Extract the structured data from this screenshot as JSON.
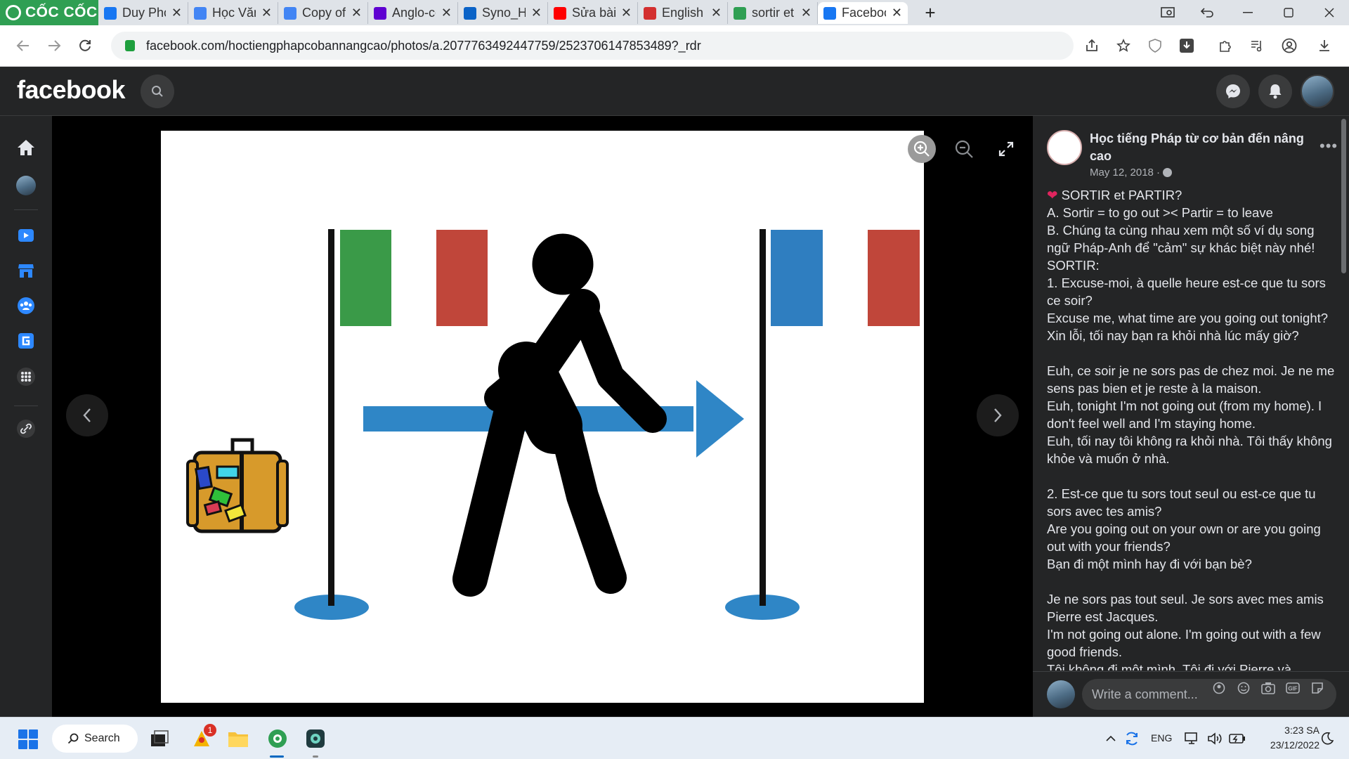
{
  "browser": {
    "brand": "CỐC CỐC",
    "tabs": [
      {
        "label": "Duy Phong",
        "favicon": "facebook-icon",
        "color": "#1877f2"
      },
      {
        "label": "Học Văn c",
        "favicon": "docs-icon",
        "color": "#4285f4"
      },
      {
        "label": "Copy of D",
        "favicon": "docs-icon",
        "color": "#4285f4"
      },
      {
        "label": "Anglo-cor",
        "favicon": "yahoo-icon",
        "color": "#5f01d1"
      },
      {
        "label": "Syno_Hyp",
        "favicon": "dsm-icon",
        "color": "#0b63c7"
      },
      {
        "label": "Sửa bài tậ",
        "favicon": "youtube-icon",
        "color": "#ff0000"
      },
      {
        "label": "English Tr",
        "favicon": "c-icon",
        "color": "#d32f2f"
      },
      {
        "label": "sortir et p",
        "favicon": "coccoc-icon",
        "color": "#2f9f53"
      },
      {
        "label": "Facebook",
        "favicon": "facebook-icon",
        "color": "#1877f2"
      }
    ],
    "url": "facebook.com/hoctiengphapcobannangcao/photos/a.2077763492447759/2523706147853489?_rdr"
  },
  "facebook": {
    "logo_text": "facebook"
  },
  "post": {
    "page_name": "Học tiếng Pháp từ cơ bản đến nâng cao",
    "date": "May 12, 2018 ·",
    "lines": [
      {
        "text": "SORTIR et PARTIR?",
        "heart": true
      },
      {
        "text": "A. Sortir = to go out >< Partir = to leave"
      },
      {
        "text": "B. Chúng ta cùng nhau xem một số ví dụ song ngữ Pháp-Anh để \"cảm\" sự khác biệt này nhé!"
      },
      {
        "text": "SORTIR:"
      },
      {
        "text": "1. Excuse-moi, à quelle heure est-ce que tu sors ce soir?"
      },
      {
        "text": "Excuse me, what time are you going out tonight?"
      },
      {
        "text": "Xin lỗi, tối nay bạn ra khỏi nhà lúc mấy giờ?"
      },
      {
        "text": ""
      },
      {
        "text": "Euh, ce soir je ne sors pas de chez moi. Je ne me sens pas bien et je reste à la maison."
      },
      {
        "text": "Euh, tonight I'm not going out (from my home). I don't feel well and I'm staying home."
      },
      {
        "text": "Euh, tối nay tôi không ra khỏi nhà. Tôi thấy không khỏe và muốn ở nhà."
      },
      {
        "text": ""
      },
      {
        "text": "2. Est-ce que tu sors tout seul ou est-ce que tu sors avec tes amis?"
      },
      {
        "text": "Are you going out on your own or are you going out with your friends?"
      },
      {
        "text": "Bạn đi một mình hay đi với bạn bè?"
      },
      {
        "text": ""
      },
      {
        "text": "Je ne sors pas tout seul. Je sors avec mes amis Pierre est Jacques."
      },
      {
        "text": "I'm not going out alone. I'm going out with a few good friends."
      },
      {
        "text": "Tôi không đi một mình. Tôi đi với Pierre và"
      }
    ],
    "comment_placeholder": "Write a comment..."
  },
  "taskbar": {
    "search_label": "Search",
    "notification_count": "1",
    "language": "ENG",
    "time": "3:23 SA",
    "date": "23/12/2022"
  },
  "colors": {
    "italy_green": "#3a9a48",
    "italy_red": "#c0463a",
    "france_blue": "#2f7ec0",
    "france_red": "#c0463a",
    "arrow_blue": "#2f86c6",
    "suitcase": "#d79a2b"
  }
}
